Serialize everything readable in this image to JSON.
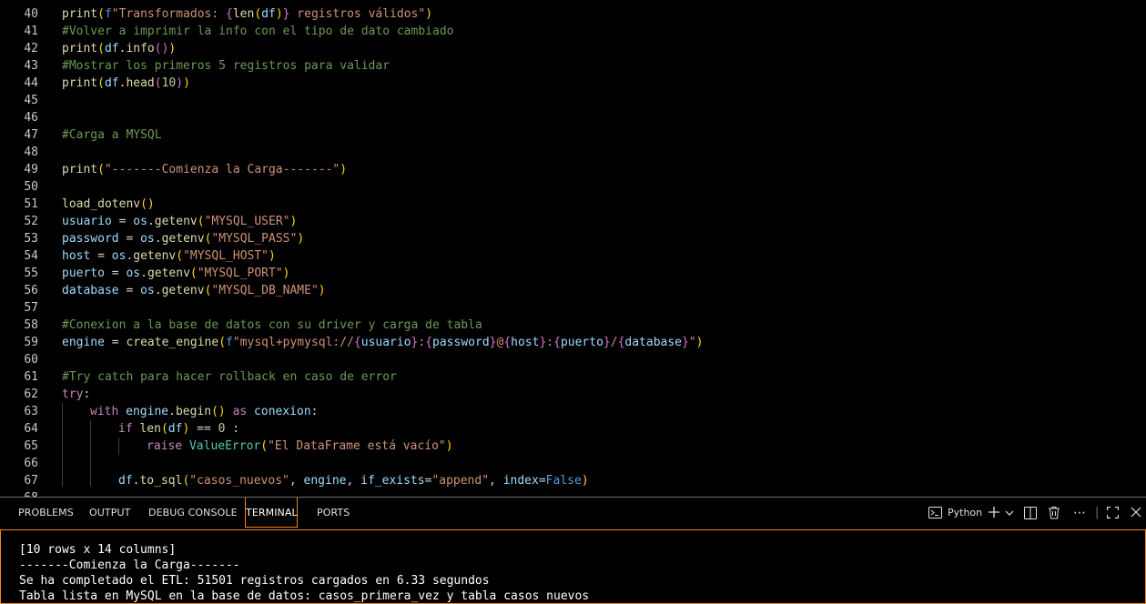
{
  "editor": {
    "lines": [
      {
        "n": "40",
        "tokens": [
          [
            "fn",
            "print"
          ],
          [
            "b1",
            "("
          ],
          [
            "const",
            "f"
          ],
          [
            "str",
            "\"Transformados: "
          ],
          [
            "b2",
            "{"
          ],
          [
            "fn",
            "len"
          ],
          [
            "b1",
            "("
          ],
          [
            "var",
            "df"
          ],
          [
            "b1",
            ")"
          ],
          [
            "b2",
            "}"
          ],
          [
            "str",
            " registros válidos\""
          ],
          [
            "b1",
            ")"
          ]
        ]
      },
      {
        "n": "41",
        "tokens": [
          [
            "cmt",
            "#Volver a imprimir la info con el tipo de dato cambiado"
          ]
        ]
      },
      {
        "n": "42",
        "tokens": [
          [
            "fn",
            "print"
          ],
          [
            "b1",
            "("
          ],
          [
            "var",
            "df"
          ],
          [
            "def",
            "."
          ],
          [
            "fn",
            "info"
          ],
          [
            "b2",
            "()"
          ],
          [
            "b1",
            ")"
          ]
        ]
      },
      {
        "n": "43",
        "tokens": [
          [
            "cmt",
            "#Mostrar los primeros 5 registros para validar"
          ]
        ]
      },
      {
        "n": "44",
        "tokens": [
          [
            "fn",
            "print"
          ],
          [
            "b1",
            "("
          ],
          [
            "var",
            "df"
          ],
          [
            "def",
            "."
          ],
          [
            "fn",
            "head"
          ],
          [
            "b2",
            "("
          ],
          [
            "num",
            "10"
          ],
          [
            "b2",
            ")"
          ],
          [
            "b1",
            ")"
          ]
        ]
      },
      {
        "n": "45",
        "tokens": []
      },
      {
        "n": "46",
        "tokens": []
      },
      {
        "n": "47",
        "tokens": [
          [
            "cmt",
            "#Carga a MYSQL"
          ]
        ]
      },
      {
        "n": "48",
        "tokens": []
      },
      {
        "n": "49",
        "tokens": [
          [
            "fn",
            "print"
          ],
          [
            "b1",
            "("
          ],
          [
            "str",
            "\"-------Comienza la Carga-------\""
          ],
          [
            "b1",
            ")"
          ]
        ]
      },
      {
        "n": "50",
        "tokens": []
      },
      {
        "n": "51",
        "tokens": [
          [
            "fn",
            "load_dotenv"
          ],
          [
            "b1",
            "()"
          ]
        ]
      },
      {
        "n": "52",
        "tokens": [
          [
            "var",
            "usuario"
          ],
          [
            "op",
            " = "
          ],
          [
            "var",
            "os"
          ],
          [
            "def",
            "."
          ],
          [
            "fn",
            "getenv"
          ],
          [
            "b1",
            "("
          ],
          [
            "str",
            "\"MYSQL_USER\""
          ],
          [
            "b1",
            ")"
          ]
        ]
      },
      {
        "n": "53",
        "tokens": [
          [
            "var",
            "password"
          ],
          [
            "op",
            " = "
          ],
          [
            "var",
            "os"
          ],
          [
            "def",
            "."
          ],
          [
            "fn",
            "getenv"
          ],
          [
            "b1",
            "("
          ],
          [
            "str",
            "\"MYSQL_PASS\""
          ],
          [
            "b1",
            ")"
          ]
        ]
      },
      {
        "n": "54",
        "tokens": [
          [
            "var",
            "host"
          ],
          [
            "op",
            " = "
          ],
          [
            "var",
            "os"
          ],
          [
            "def",
            "."
          ],
          [
            "fn",
            "getenv"
          ],
          [
            "b1",
            "("
          ],
          [
            "str",
            "\"MYSQL_HOST\""
          ],
          [
            "b1",
            ")"
          ]
        ]
      },
      {
        "n": "55",
        "tokens": [
          [
            "var",
            "puerto"
          ],
          [
            "op",
            " = "
          ],
          [
            "var",
            "os"
          ],
          [
            "def",
            "."
          ],
          [
            "fn",
            "getenv"
          ],
          [
            "b1",
            "("
          ],
          [
            "str",
            "\"MYSQL_PORT\""
          ],
          [
            "b1",
            ")"
          ]
        ]
      },
      {
        "n": "56",
        "tokens": [
          [
            "var",
            "database"
          ],
          [
            "op",
            " = "
          ],
          [
            "var",
            "os"
          ],
          [
            "def",
            "."
          ],
          [
            "fn",
            "getenv"
          ],
          [
            "b1",
            "("
          ],
          [
            "str",
            "\"MYSQL_DB_NAME\""
          ],
          [
            "b1",
            ")"
          ]
        ]
      },
      {
        "n": "57",
        "tokens": []
      },
      {
        "n": "58",
        "tokens": [
          [
            "cmt",
            "#Conexion a la base de datos con su driver y carga de tabla"
          ]
        ]
      },
      {
        "n": "59",
        "tokens": [
          [
            "var",
            "engine"
          ],
          [
            "op",
            " = "
          ],
          [
            "fn",
            "create_engine"
          ],
          [
            "b1",
            "("
          ],
          [
            "const",
            "f"
          ],
          [
            "str",
            "\"mysql+pymysql://"
          ],
          [
            "b2",
            "{"
          ],
          [
            "var",
            "usuario"
          ],
          [
            "b2",
            "}"
          ],
          [
            "str",
            ":"
          ],
          [
            "b2",
            "{"
          ],
          [
            "var",
            "password"
          ],
          [
            "b2",
            "}"
          ],
          [
            "str",
            "@"
          ],
          [
            "b2",
            "{"
          ],
          [
            "var",
            "host"
          ],
          [
            "b2",
            "}"
          ],
          [
            "str",
            ":"
          ],
          [
            "b2",
            "{"
          ],
          [
            "var",
            "puerto"
          ],
          [
            "b2",
            "}"
          ],
          [
            "str",
            "/"
          ],
          [
            "b2",
            "{"
          ],
          [
            "var",
            "database"
          ],
          [
            "b2",
            "}"
          ],
          [
            "str",
            "\""
          ],
          [
            "b1",
            ")"
          ]
        ]
      },
      {
        "n": "60",
        "tokens": []
      },
      {
        "n": "61",
        "tokens": [
          [
            "cmt",
            "#Try catch para hacer rollback en caso de error"
          ]
        ]
      },
      {
        "n": "62",
        "tokens": [
          [
            "kw",
            "try"
          ],
          [
            "def",
            ":"
          ]
        ]
      },
      {
        "n": "63",
        "indent": 1,
        "tokens": [
          [
            "kw",
            "with"
          ],
          [
            "def",
            " "
          ],
          [
            "var",
            "engine"
          ],
          [
            "def",
            "."
          ],
          [
            "fn",
            "begin"
          ],
          [
            "b1",
            "()"
          ],
          [
            "def",
            " "
          ],
          [
            "kw",
            "as"
          ],
          [
            "def",
            " "
          ],
          [
            "var",
            "conexion"
          ],
          [
            "def",
            ":"
          ]
        ]
      },
      {
        "n": "64",
        "indent": 2,
        "tokens": [
          [
            "kw",
            "if"
          ],
          [
            "def",
            " "
          ],
          [
            "fn",
            "len"
          ],
          [
            "b1",
            "("
          ],
          [
            "var",
            "df"
          ],
          [
            "b1",
            ")"
          ],
          [
            "op",
            " == "
          ],
          [
            "num",
            "0"
          ],
          [
            "def",
            " :"
          ]
        ]
      },
      {
        "n": "65",
        "indent": 3,
        "tokens": [
          [
            "kw",
            "raise"
          ],
          [
            "def",
            " "
          ],
          [
            "cls",
            "ValueError"
          ],
          [
            "b1",
            "("
          ],
          [
            "str",
            "\"El DataFrame está vacío\""
          ],
          [
            "b1",
            ")"
          ]
        ]
      },
      {
        "n": "66",
        "tokens": []
      },
      {
        "n": "67",
        "indent": 2,
        "tokens": [
          [
            "var",
            "df"
          ],
          [
            "def",
            "."
          ],
          [
            "fn",
            "to_sql"
          ],
          [
            "b1",
            "("
          ],
          [
            "str",
            "\"casos_nuevos\""
          ],
          [
            "def",
            ", "
          ],
          [
            "var",
            "engine"
          ],
          [
            "def",
            ", "
          ],
          [
            "var",
            "if_exists"
          ],
          [
            "op",
            "="
          ],
          [
            "str",
            "\"append\""
          ],
          [
            "def",
            ", "
          ],
          [
            "var",
            "index"
          ],
          [
            "op",
            "="
          ],
          [
            "const",
            "False"
          ],
          [
            "b1",
            ")"
          ]
        ]
      },
      {
        "n": "68",
        "tokens": []
      }
    ]
  },
  "panel": {
    "tabs": [
      "PROBLEMS",
      "OUTPUT",
      "DEBUG CONSOLE",
      "TERMINAL",
      "PORTS"
    ],
    "active_tab": "TERMINAL",
    "terminal_profile": "Python",
    "icons": [
      "terminal-icon",
      "add-icon",
      "chevron-down-icon",
      "split-icon",
      "trash-icon",
      "more-icon",
      "maximize-icon",
      "close-icon"
    ]
  },
  "terminal": {
    "lines": [
      "[10 rows x 14 columns]",
      "-------Comienza la Carga-------",
      "Se ha completado el ETL: 51501 registros cargados en 6.33 segundos",
      "Tabla lista en MySQL en la base de datos: casos_primera_vez y tabla casos nuevos"
    ]
  }
}
